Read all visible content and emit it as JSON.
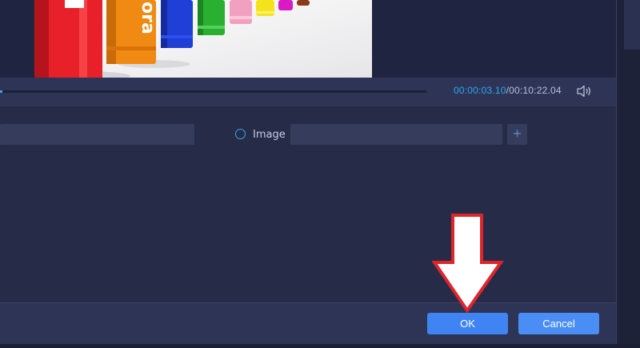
{
  "preview": {
    "label_fragment": "ora"
  },
  "timeline": {
    "current_time": "00:00:03.10",
    "separator": "/",
    "total_time": "00:10:22.04",
    "progress_fraction": 0.005
  },
  "watermark": {
    "text_value": "",
    "image_label": "Image",
    "image_path": "",
    "add_label": "+"
  },
  "footer": {
    "ok_label": "OK",
    "cancel_label": "Cancel"
  },
  "colors": {
    "accent": "#3aa0e8",
    "button_primary": "#3f84f2",
    "annotation_red": "#e0242c"
  },
  "icons": {
    "volume": "volume-icon",
    "add": "plus-icon",
    "annotation": "down-arrow-icon"
  }
}
